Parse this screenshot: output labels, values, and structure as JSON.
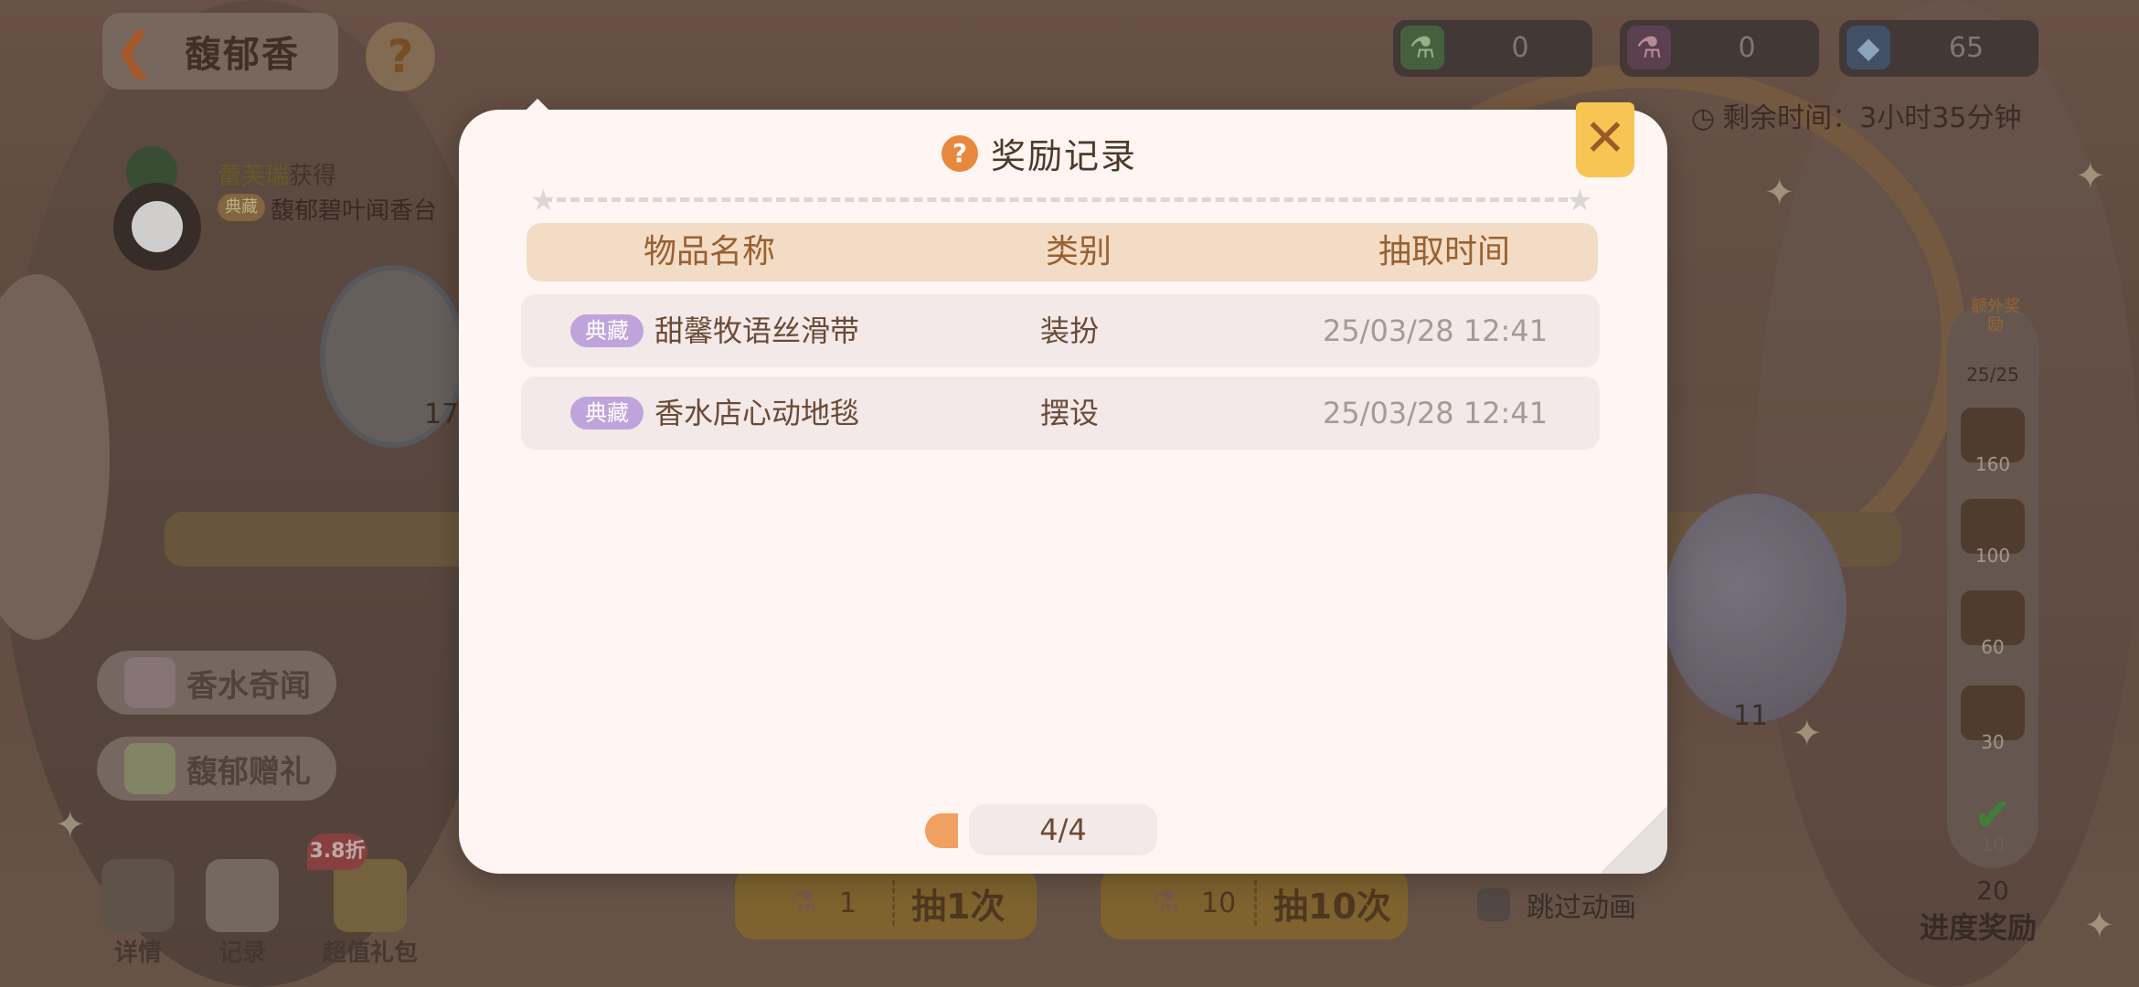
{
  "header": {
    "back_title": "馥郁香",
    "help_glyph": "?"
  },
  "notice": {
    "player": "蕾芙瑞",
    "action": "获得",
    "badge": "典藏",
    "item": "馥郁碧叶闻香台"
  },
  "currencies": [
    {
      "icon": "pink-bottle-icon",
      "value": "0"
    },
    {
      "icon": "red-bottle-icon",
      "value": "0"
    },
    {
      "icon": "blue-gem-icon",
      "value": "65"
    }
  ],
  "timer": {
    "label": "剩余时间：3小时35分钟"
  },
  "side_buttons": [
    {
      "label": "香水奇闻"
    },
    {
      "label": "馥郁赠礼"
    }
  ],
  "bottom_tools": [
    {
      "label": "详情"
    },
    {
      "label": "记录"
    },
    {
      "label": "超值礼包"
    }
  ],
  "sale_badge": "3.8折",
  "draw_buttons": [
    {
      "count": "1",
      "label": "抽1次"
    },
    {
      "count": "10",
      "label": "抽10次"
    }
  ],
  "skip_animation": {
    "label": "跳过动画",
    "checked": false
  },
  "background_counts": {
    "bottle_count": "17",
    "orb_count": "11"
  },
  "progress": {
    "extra_label": "额外奖励",
    "count": "25/25",
    "milestones": [
      "160",
      "100",
      "60",
      "30"
    ],
    "claimed": "10",
    "current": "20",
    "title": "进度奖励"
  },
  "modal": {
    "title": "奖励记录",
    "help_glyph": "?",
    "close_glyph": "✕",
    "columns": [
      "物品名称",
      "类别",
      "抽取时间"
    ],
    "rows": [
      {
        "tag": "典藏",
        "name": "甜馨牧语丝滑带",
        "category": "装扮",
        "time": "25/03/28 12:41"
      },
      {
        "tag": "典藏",
        "name": "香水店心动地毯",
        "category": "摆设",
        "time": "25/03/28 12:41"
      }
    ],
    "pager": "4/4"
  },
  "colors": {
    "modal_bg": "#fff6f3",
    "header_bg": "#f3dcc6",
    "header_text": "#9a6030",
    "tag_bg": "#bfa4db",
    "close_bg": "#f7c553",
    "accent_orange": "#e8883c"
  }
}
